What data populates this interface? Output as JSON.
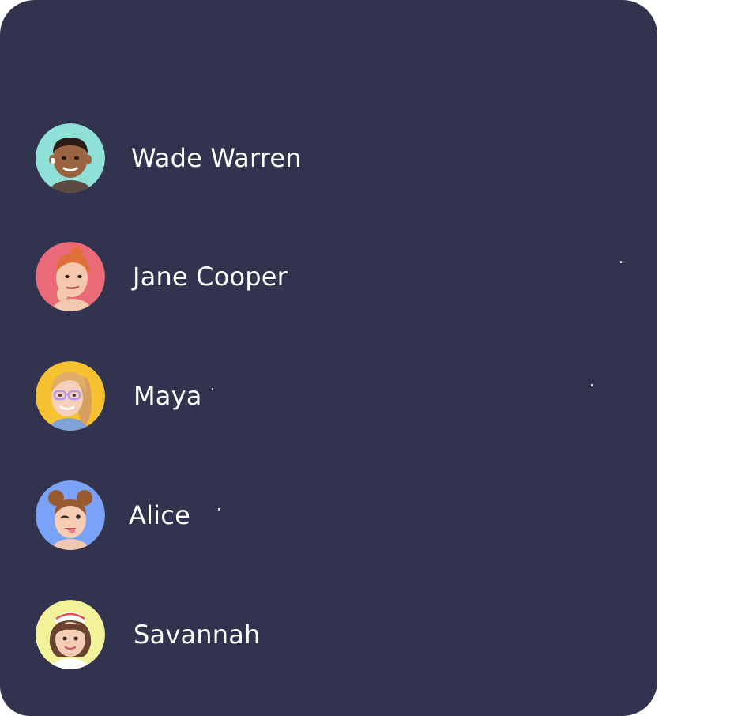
{
  "contacts": [
    {
      "name": "Wade Warren",
      "avatar_bg": "#8fe0d6",
      "avatar_icon": "man-avatar-icon"
    },
    {
      "name": "Jane Cooper",
      "avatar_bg": "#ea6a78",
      "avatar_icon": "woman-red-hair-avatar-icon"
    },
    {
      "name": "Maya",
      "avatar_bg": "#f7c232",
      "avatar_icon": "woman-glasses-braids-avatar-icon"
    },
    {
      "name": "Alice",
      "avatar_bg": "#7aa2f7",
      "avatar_icon": "girl-winking-avatar-icon"
    },
    {
      "name": "Savannah",
      "avatar_bg": "#f2f29a",
      "avatar_icon": "nurse-avatar-icon"
    }
  ],
  "colors": {
    "panel_bg": "#32334f",
    "text": "#ffffff"
  }
}
